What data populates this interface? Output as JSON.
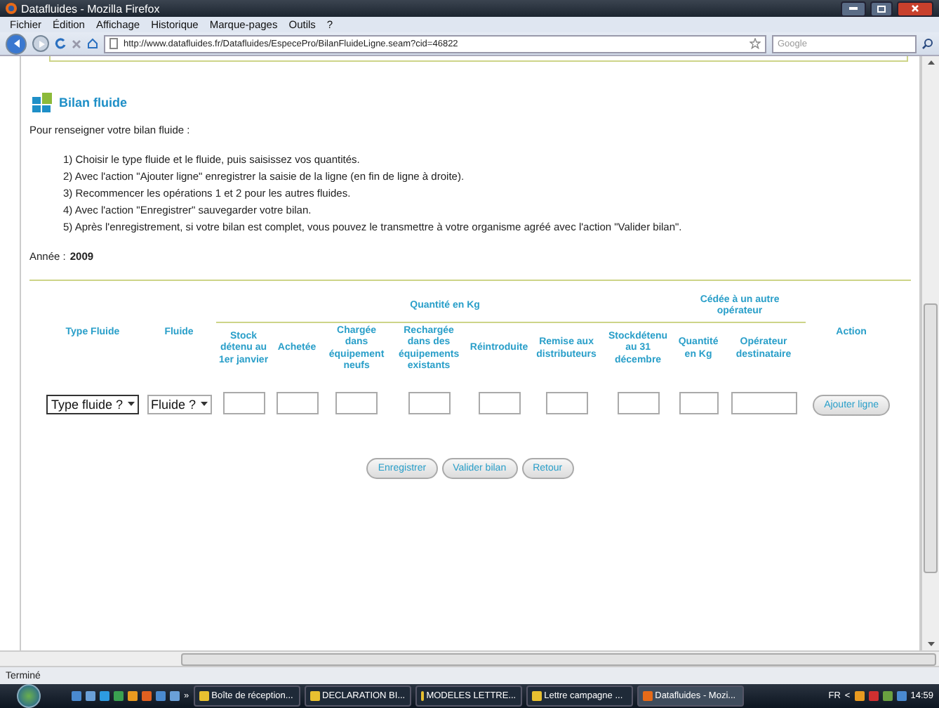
{
  "window": {
    "title": "Datafluides - Mozilla Firefox"
  },
  "menu": [
    {
      "label": "Fichier"
    },
    {
      "label": "Édition"
    },
    {
      "label": "Affichage"
    },
    {
      "label": "Historique"
    },
    {
      "label": "Marque-pages"
    },
    {
      "label": "Outils"
    },
    {
      "label": "?"
    }
  ],
  "address_bar": {
    "url": "http://www.datafluides.fr/Datafluides/EspecePro/BilanFluideLigne.seam?cid=46822"
  },
  "search": {
    "placeholder": "Google"
  },
  "page": {
    "title": "Bilan fluide",
    "intro": "Pour renseigner votre bilan fluide :",
    "steps": [
      "1) Choisir le type fluide et le fluide, puis saisissez vos quantités.",
      "2) Avec l'action \"Ajouter ligne\" enregistrer la saisie de la ligne (en fin de ligne à droite).",
      "3) Recommencer les opérations 1 et 2 pour les autres fluides.",
      "4) Avec l'action \"Enregistrer\" sauvegarder votre bilan.",
      "5) Après l'enregistrement, si votre bilan est complet, vous pouvez le transmettre à votre organisme agréé avec l'action \"Valider bilan\"."
    ],
    "year_label": "Année :",
    "year": "2009"
  },
  "table": {
    "type_header": "Type Fluide",
    "fluid_header": "Fluide",
    "quantity_group": "Quantité en Kg",
    "quantity_columns": [
      "Stock détenu au 1er janvier",
      "Achetée",
      "Chargée dans équipement neufs",
      "Rechargée dans des équipements existants",
      "Réintroduite",
      "Remise aux distributeurs",
      "Stockdétenu au 31 décembre"
    ],
    "transfer_group": "Cédée à un autre opérateur",
    "transfer_columns": [
      "Quantité en Kg",
      "Opérateur destinataire"
    ],
    "action_header": "Action",
    "type_select": "Type fluide ?",
    "fluid_select": "Fluide ?",
    "add_button": "Ajouter ligne"
  },
  "buttons": [
    "Enregistrer",
    "Valider bilan",
    "Retour"
  ],
  "status_bar": "Terminé",
  "taskbar": {
    "more": "»",
    "tasks": [
      {
        "label": "Boîte de réception...",
        "selected": false
      },
      {
        "label": "DECLARATION BI...",
        "selected": false
      },
      {
        "label": "MODELES LETTRE...",
        "selected": false
      },
      {
        "label": "Lettre campagne ...",
        "selected": false
      },
      {
        "label": "Datafluides - Mozi...",
        "selected": true
      }
    ],
    "language": "FR",
    "tray_arrow": "<",
    "clock": "14:59"
  }
}
